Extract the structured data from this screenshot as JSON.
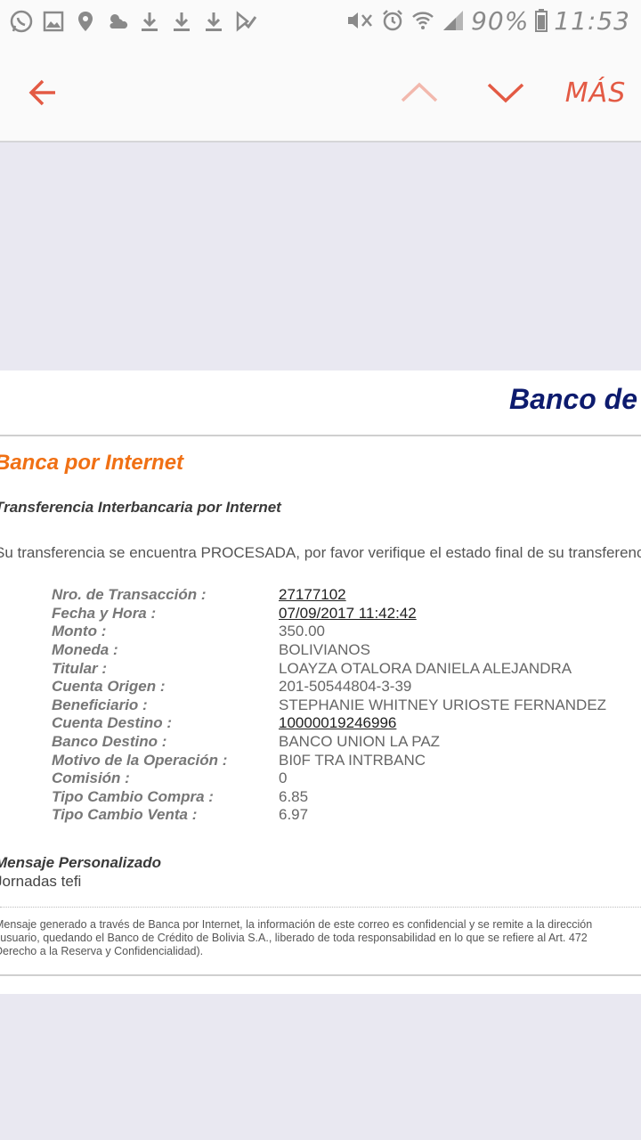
{
  "status_bar": {
    "left_icons": [
      "whatsapp-icon",
      "image-icon",
      "location-icon",
      "weather-icon",
      "download-icon",
      "download-icon",
      "download-icon",
      "check-icon"
    ],
    "battery": "90%",
    "time": "11:53"
  },
  "toolbar": {
    "back_icon": "arrow-left-icon",
    "prev_icon": "chevron-up-icon",
    "next_icon": "chevron-down-icon",
    "more_label": "MÁS",
    "accent": "#e35a44"
  },
  "email": {
    "bank_title": "Banco de",
    "banca": "Banca por Internet",
    "subtitle": "Transferencia Interbancaria por Internet",
    "message": "Su transferencia se encuentra PROCESADA, por favor verifique el estado final de su transferencia",
    "details": [
      {
        "label": "Nro. de Transacción :",
        "value": "27177102",
        "link": true
      },
      {
        "label": "Fecha y Hora :",
        "value": "07/09/2017 11:42:42",
        "link": true
      },
      {
        "label": "Monto :",
        "value": "350.00",
        "link": false
      },
      {
        "label": "Moneda :",
        "value": "BOLIVIANOS",
        "link": false
      },
      {
        "label": "Titular :",
        "value": "LOAYZA OTALORA DANIELA ALEJANDRA",
        "link": false
      },
      {
        "label": "Cuenta Origen :",
        "value": "201-50544804-3-39",
        "link": false
      },
      {
        "label": "Beneficiario :",
        "value": "STEPHANIE WHITNEY URIOSTE FERNANDEZ",
        "link": false
      },
      {
        "label": "Cuenta Destino :",
        "value": "10000019246996",
        "link": true
      },
      {
        "label": "Banco Destino :",
        "value": "BANCO UNION LA PAZ",
        "link": false
      },
      {
        "label": "Motivo de la Operación :",
        "value": "BI0F TRA INTRBANC",
        "link": false
      },
      {
        "label": "Comisión :",
        "value": "0",
        "link": false
      },
      {
        "label": "Tipo Cambio Compra :",
        "value": "6.85",
        "link": false
      },
      {
        "label": "Tipo Cambio Venta :",
        "value": "6.97",
        "link": false
      }
    ],
    "msg_head": "Mensaje Personalizado",
    "msg_body": "Jornadas tefi",
    "disclaimer_1": "Mensaje generado a través de Banca por Internet, la información de este correo es confidencial y se remite a la dirección",
    "disclaimer_2": "l usuario, quedando el Banco de Crédito de Bolivia S.A., liberado de toda responsabilidad en lo que se refiere al Art. 472",
    "disclaimer_3": "Derecho a la Reserva y Confidencialidad)."
  }
}
